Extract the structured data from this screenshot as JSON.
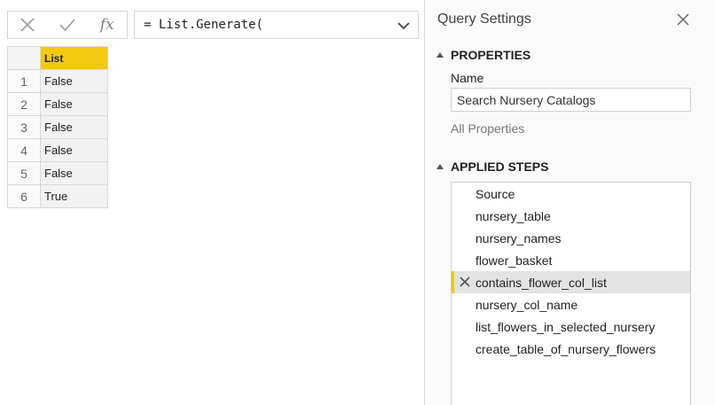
{
  "formula_bar": {
    "cancel_icon": "x-icon",
    "commit_icon": "check-icon",
    "fx_label": "fx",
    "formula_text": "= List.Generate(",
    "expand_icon": "chevron-down-icon"
  },
  "grid": {
    "column_header": "List",
    "rows": [
      {
        "num": "1",
        "value": "False"
      },
      {
        "num": "2",
        "value": "False"
      },
      {
        "num": "3",
        "value": "False"
      },
      {
        "num": "4",
        "value": "False"
      },
      {
        "num": "5",
        "value": "False"
      },
      {
        "num": "6",
        "value": "True"
      }
    ],
    "header_color": "#f2c811"
  },
  "query_settings": {
    "title": "Query Settings",
    "close_icon": "close-icon",
    "properties": {
      "heading": "PROPERTIES",
      "name_label": "Name",
      "name_value": "Search Nursery Catalogs",
      "all_properties_link": "All Properties"
    },
    "applied_steps": {
      "heading": "APPLIED STEPS",
      "steps": [
        {
          "label": "Source"
        },
        {
          "label": "nursery_table"
        },
        {
          "label": "nursery_names"
        },
        {
          "label": "flower_basket"
        },
        {
          "label": "contains_flower_col_list",
          "selected": true
        },
        {
          "label": "nursery_col_name"
        },
        {
          "label": "list_flowers_in_selected_nursery"
        },
        {
          "label": "create_table_of_nursery_flowers"
        }
      ],
      "selected_marker_color": "#f2c811"
    }
  }
}
